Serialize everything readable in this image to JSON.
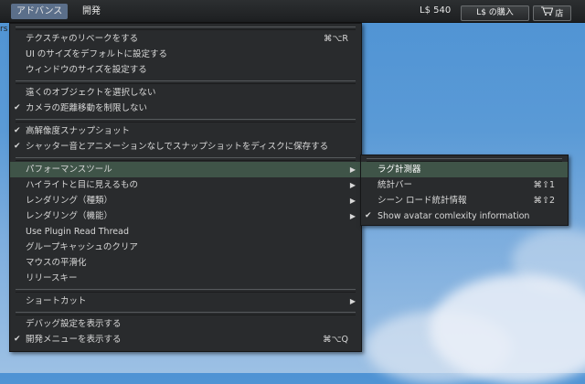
{
  "topbar": {
    "menus": [
      "アドバンス",
      "開発"
    ],
    "balance": "L$ 540",
    "buy_label": "L$ の購入",
    "shop_label": "店"
  },
  "left_stub": "rs",
  "menu": {
    "items": [
      {
        "label": "テクスチャのリベークをする",
        "shortcut": "⌘⌥R"
      },
      {
        "label": "UI のサイズをデフォルトに設定する"
      },
      {
        "label": "ウィンドウのサイズを設定する"
      },
      {
        "label": "遠くのオブジェクトを選択しない"
      },
      {
        "label": "カメラの距離移動を制限しない",
        "checked": "✔"
      },
      {
        "label": "高解像度スナップショット",
        "checked": "✔"
      },
      {
        "label": "シャッター音とアニメーションなしでスナップショットをディスクに保存する",
        "checked": "✔"
      },
      {
        "label": "パフォーマンスツール",
        "arrow": "▶"
      },
      {
        "label": "ハイライトと目に見えるもの",
        "arrow": "▶"
      },
      {
        "label": "レンダリング（種類）",
        "arrow": "▶"
      },
      {
        "label": "レンダリング（機能）",
        "arrow": "▶"
      },
      {
        "label": "Use Plugin Read Thread"
      },
      {
        "label": "グループキャッシュのクリア"
      },
      {
        "label": "マウスの平滑化"
      },
      {
        "label": "リリースキー"
      },
      {
        "label": "ショートカット",
        "arrow": "▶"
      },
      {
        "label": "デバッグ設定を表示する"
      },
      {
        "label": "開発メニューを表示する",
        "checked": "✔",
        "shortcut": "⌘⌥Q"
      }
    ]
  },
  "submenu": {
    "items": [
      {
        "label": "ラグ計測器"
      },
      {
        "label": "統計バー",
        "shortcut": "⌘⇧1"
      },
      {
        "label": "シーン ロード統計情報",
        "shortcut": "⌘⇧2"
      },
      {
        "label": "Show avatar comlexity information",
        "checked": "✔"
      }
    ]
  },
  "colors": {
    "highlight": "#3f5448",
    "menu_bg": "#292b2d",
    "active_menu": "#5b6f8a"
  }
}
